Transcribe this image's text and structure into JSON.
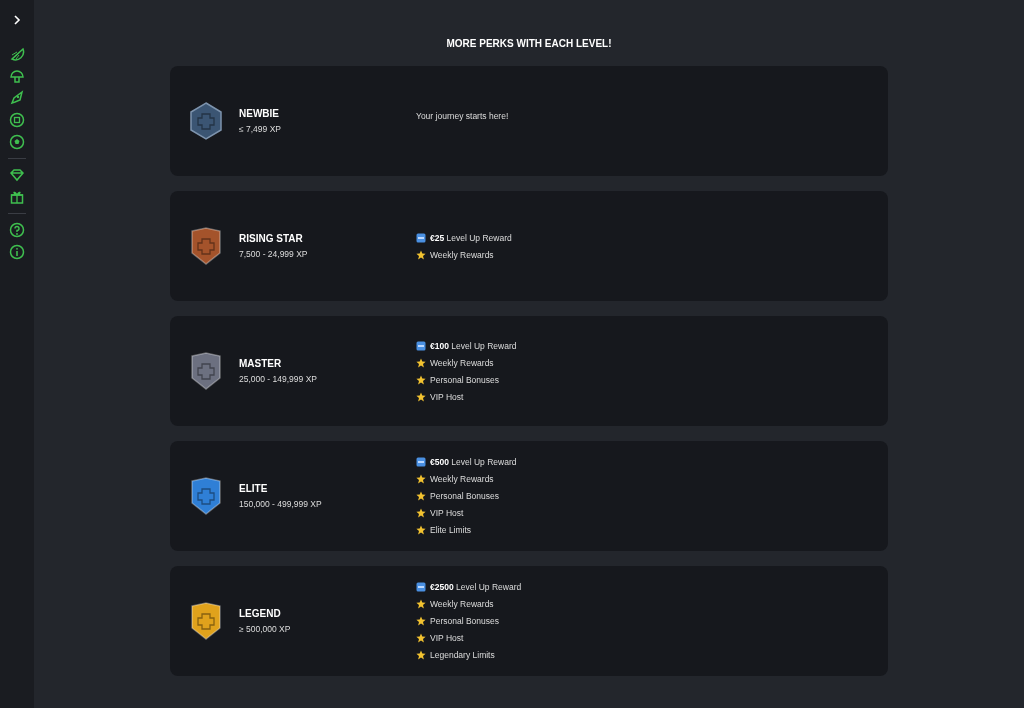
{
  "heading": "MORE PERKS WITH EACH LEVEL!",
  "levels": [
    {
      "name": "NEWBIE",
      "xp": "≤ 7,499 XP",
      "kind": "hexagon",
      "color": "#3b5573",
      "note": "Your journey starts here!"
    },
    {
      "name": "RISING STAR",
      "xp": "7,500 - 24,999 XP",
      "kind": "shield",
      "color": "#a4532b",
      "perks": [
        {
          "kind": "reward",
          "text": "**€25** Level Up Reward"
        },
        {
          "kind": "star",
          "text": "Weekly Rewards"
        }
      ]
    },
    {
      "name": "MASTER",
      "xp": "25,000 - 149,999 XP",
      "kind": "shield",
      "color": "#6c7080",
      "perks": [
        {
          "kind": "reward",
          "text": "**€100** Level Up Reward"
        },
        {
          "kind": "star",
          "text": "Weekly Rewards"
        },
        {
          "kind": "star",
          "text": "Personal Bonuses"
        },
        {
          "kind": "star",
          "text": "VIP Host"
        }
      ]
    },
    {
      "name": "ELITE",
      "xp": "150,000 - 499,999 XP",
      "kind": "shield",
      "color": "#2f7fd6",
      "perks": [
        {
          "kind": "reward",
          "text": "**€500** Level Up Reward"
        },
        {
          "kind": "star",
          "text": "Weekly Rewards"
        },
        {
          "kind": "star",
          "text": "Personal Bonuses"
        },
        {
          "kind": "star",
          "text": "VIP Host"
        },
        {
          "kind": "star",
          "text": "Elite Limits"
        }
      ]
    },
    {
      "name": "LEGEND",
      "xp": "≥ 500,000 XP",
      "kind": "shield",
      "color": "#e0a21c",
      "perks": [
        {
          "kind": "reward",
          "text": "**€2500** Level Up Reward"
        },
        {
          "kind": "star",
          "text": "Weekly Rewards"
        },
        {
          "kind": "star",
          "text": "Personal Bonuses"
        },
        {
          "kind": "star",
          "text": "VIP Host"
        },
        {
          "kind": "star",
          "text": "Legendary Limits"
        }
      ]
    }
  ]
}
